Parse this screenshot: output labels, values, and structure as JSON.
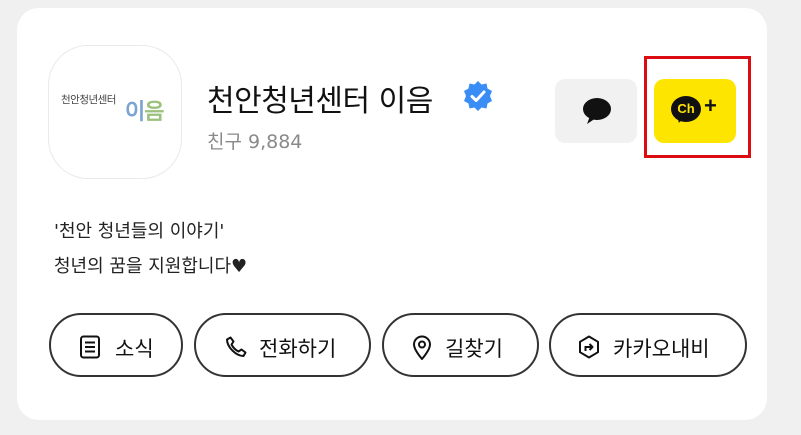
{
  "profile": {
    "avatar_text": "천안청년센터",
    "avatar_logo_part1": "이",
    "avatar_logo_part2": "음",
    "name": "천안청년센터 이음",
    "friends": "친구 9,884",
    "verified_icon": "verified-badge-icon"
  },
  "description": {
    "line1": "'천안 청년들의 이야기'",
    "line2": "청년의 꿈을 지원합니다♥"
  },
  "actions": {
    "chat_icon": "speech-bubble-icon",
    "channel_text": "Ch",
    "channel_plus": "+"
  },
  "buttons": [
    {
      "label": "소식",
      "icon": "news-icon"
    },
    {
      "label": "전화하기",
      "icon": "phone-icon"
    },
    {
      "label": "길찾기",
      "icon": "location-pin-icon"
    },
    {
      "label": "카카오내비",
      "icon": "navi-icon"
    }
  ],
  "colors": {
    "channel_button": "#fee500",
    "highlight_box": "#dc0c13",
    "verified": "#3b8df6",
    "logo_blue": "#7ba4d2",
    "logo_green": "#9ac27c"
  }
}
